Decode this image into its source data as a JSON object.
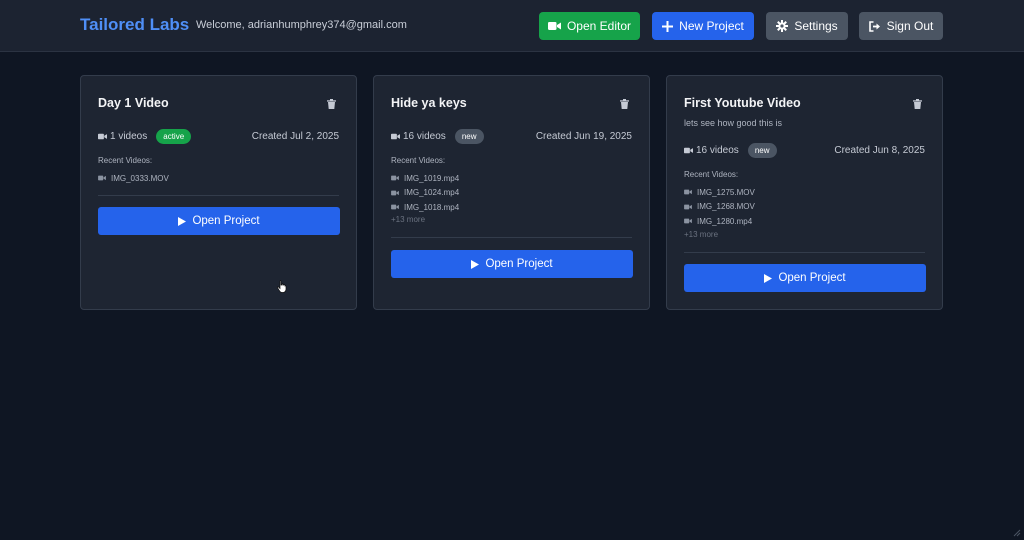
{
  "header": {
    "brand": "Tailored Labs",
    "welcome": "Welcome, adrianhumphrey374@gmail.com",
    "open_editor": "Open Editor",
    "new_project": "New Project",
    "settings": "Settings",
    "sign_out": "Sign Out"
  },
  "colors": {
    "brand": "#4f8ff7",
    "primary": "#2563eb",
    "success": "#16a34a",
    "neutral": "#4b5563",
    "background": "#0f1623",
    "card": "#1e2532"
  },
  "projects": [
    {
      "title": "Day 1 Video",
      "description": "",
      "video_count": "1 videos",
      "badge": "active",
      "created": "Created Jul 2, 2025",
      "recent_label": "Recent Videos:",
      "videos": [
        "IMG_0333.MOV"
      ],
      "more": "",
      "open_label": "Open Project"
    },
    {
      "title": "Hide ya keys",
      "description": "",
      "video_count": "16 videos",
      "badge": "new",
      "created": "Created Jun 19, 2025",
      "recent_label": "Recent Videos:",
      "videos": [
        "IMG_1019.mp4",
        "IMG_1024.mp4",
        "IMG_1018.mp4"
      ],
      "more": "+13 more",
      "open_label": "Open Project"
    },
    {
      "title": "First Youtube Video",
      "description": "lets see how good this is",
      "video_count": "16 videos",
      "badge": "new",
      "created": "Created Jun 8, 2025",
      "recent_label": "Recent Videos:",
      "videos": [
        "IMG_1275.MOV",
        "IMG_1268.MOV",
        "IMG_1280.mp4"
      ],
      "more": "+13 more",
      "open_label": "Open Project"
    }
  ],
  "icons": {
    "editor": "video-camera-icon",
    "new": "plus-icon",
    "settings": "gear-icon",
    "sign_out": "sign-out-icon",
    "delete": "trash-icon",
    "play": "play-icon"
  }
}
